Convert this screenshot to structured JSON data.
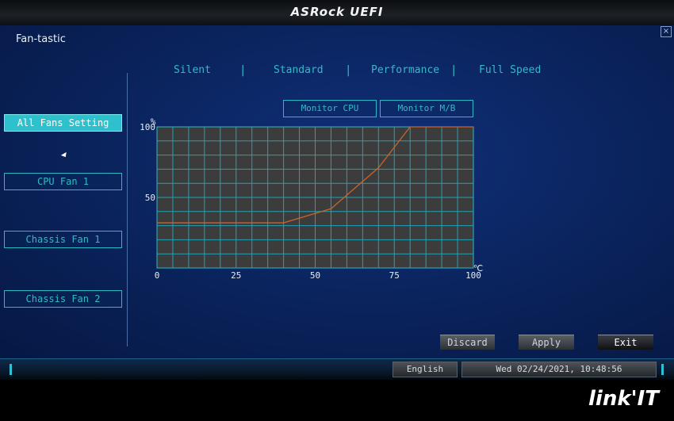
{
  "header": {
    "brand": "ASRock UEFI"
  },
  "page": {
    "title": "Fan-tastic",
    "close_symbol": "×"
  },
  "sidebar": {
    "items": [
      {
        "label": "All Fans Setting",
        "active": true
      },
      {
        "label": "CPU Fan 1",
        "active": false
      },
      {
        "label": "Chassis Fan 1",
        "active": false
      },
      {
        "label": "Chassis Fan 2",
        "active": false
      }
    ]
  },
  "modes": [
    "Silent",
    "Standard",
    "Performance",
    "Full Speed"
  ],
  "monitor": {
    "cpu_label": "Monitor CPU",
    "mb_label": "Monitor M/B"
  },
  "chart_data": {
    "type": "line",
    "ylabel": "%",
    "xlabel": "℃",
    "xlim": [
      0,
      100
    ],
    "ylim": [
      0,
      100
    ],
    "x_ticks": [
      "0",
      "25",
      "50",
      "75",
      "100"
    ],
    "y_ticks": [
      "100",
      "50"
    ],
    "grid": true,
    "series": [
      {
        "x": [
          0,
          40,
          55,
          70,
          80,
          100
        ],
        "values": [
          32,
          32,
          42,
          71,
          100,
          100
        ]
      }
    ],
    "line_color": "#c8642a"
  },
  "actions": {
    "discard": "Discard",
    "apply": "Apply",
    "exit": "Exit"
  },
  "status": {
    "language": "English",
    "datetime": "Wed 02/24/2021, 10:48:56"
  },
  "watermark": {
    "text": "link'IT"
  }
}
